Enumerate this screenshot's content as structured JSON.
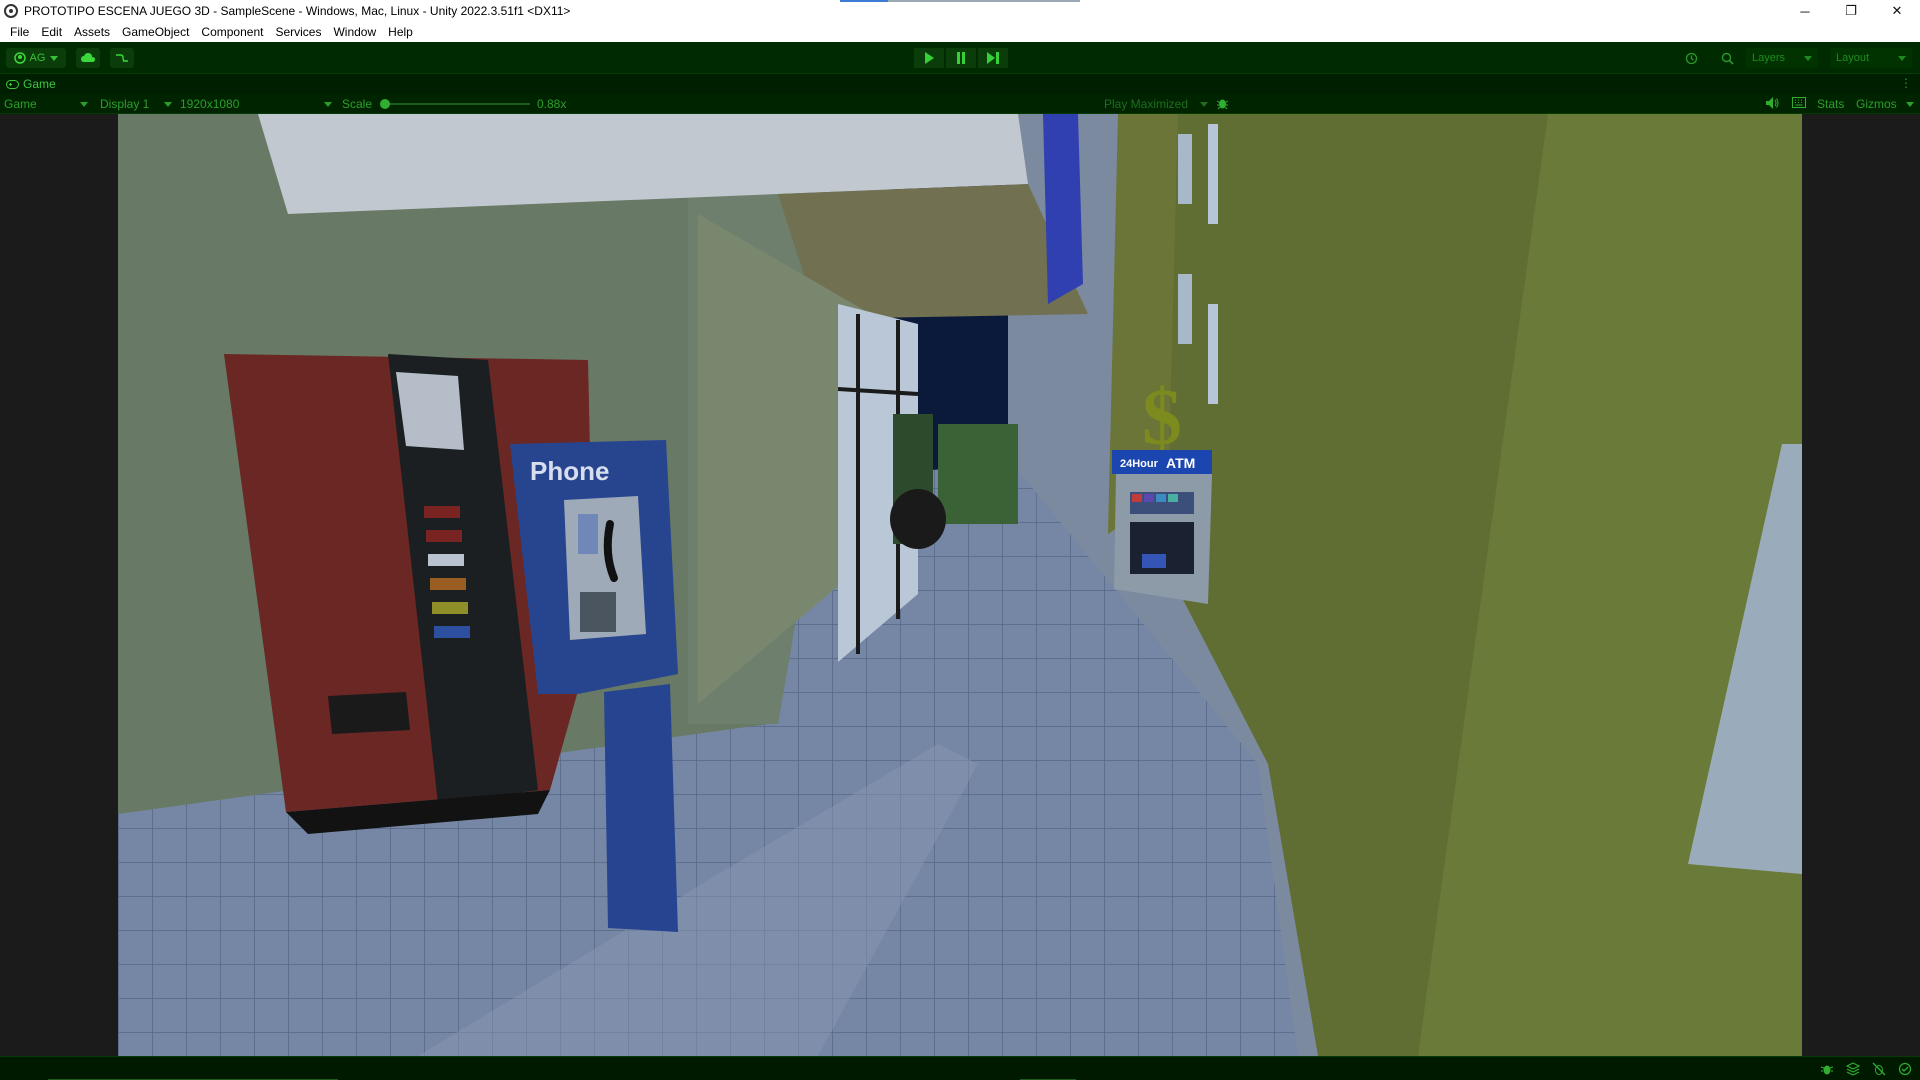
{
  "window": {
    "title": "PROTOTIPO ESCENA JUEGO 3D - SampleScene - Windows, Mac, Linux - Unity 2022.3.51f1 <DX11>",
    "minimize": "─",
    "restore": "❐",
    "close": "✕"
  },
  "menu": [
    "File",
    "Edit",
    "Assets",
    "GameObject",
    "Component",
    "Services",
    "Window",
    "Help"
  ],
  "toolbar": {
    "account_label": "AG",
    "layers_label": "Layers",
    "layout_label": "Layout"
  },
  "game_tab": {
    "label": "Game"
  },
  "game_toolbar": {
    "view_mode": "Game",
    "display": "Display 1",
    "resolution": "1920x1080",
    "scale_label": "Scale",
    "scale_value": "0.88x",
    "play_maximized": "Play Maximized",
    "stats": "Stats",
    "gizmos": "Gizmos"
  },
  "scene": {
    "phone_sign": "Phone",
    "atm_sign_small": "24Hour",
    "atm_sign_big": "ATM",
    "dollar_sign": "$"
  },
  "colors": {
    "accent": "#3bd83b",
    "toolbar_bg": "#002a00"
  }
}
